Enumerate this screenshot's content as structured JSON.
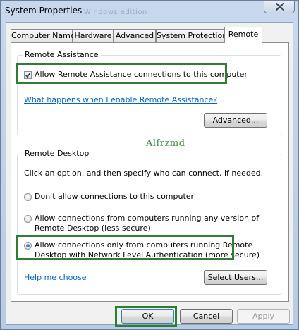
{
  "window": {
    "title": "System Properties",
    "title_ghost": "Windows edition"
  },
  "tabs": [
    {
      "label": "Computer Name",
      "active": false
    },
    {
      "label": "Hardware",
      "active": false
    },
    {
      "label": "Advanced",
      "active": false
    },
    {
      "label": "System Protection",
      "active": false
    },
    {
      "label": "Remote",
      "active": true
    }
  ],
  "remote_assistance": {
    "group_label": "Remote Assistance",
    "allow_checkbox": {
      "label": "Allow Remote Assistance connections to this computer",
      "checked": true
    },
    "help_link": "What happens when I enable Remote Assistance?",
    "advanced_button": "Advanced..."
  },
  "watermark": "Alfrzmd",
  "remote_desktop": {
    "group_label": "Remote Desktop",
    "instruction": "Click an option, and then specify who can connect, if needed.",
    "options": [
      {
        "line1": "Don't allow connections to this computer",
        "line2": "",
        "checked": false
      },
      {
        "line1": "Allow connections from computers running any version of",
        "line2": "Remote Desktop (less secure)",
        "checked": false
      },
      {
        "line1": "Allow connections only from computers running Remote",
        "line2": "Desktop with Network Level Authentication (more secure)",
        "checked": true
      }
    ],
    "help_link": "Help me choose",
    "select_users_button": "Select Users..."
  },
  "footer": {
    "ok": "OK",
    "cancel": "Cancel",
    "apply": "Apply"
  },
  "colors": {
    "highlight_box": "#2e7d32",
    "link": "#0066cc",
    "titlebar": "#c8d8ec"
  },
  "icons": {
    "close": "close-icon",
    "check": "checkmark-icon"
  }
}
